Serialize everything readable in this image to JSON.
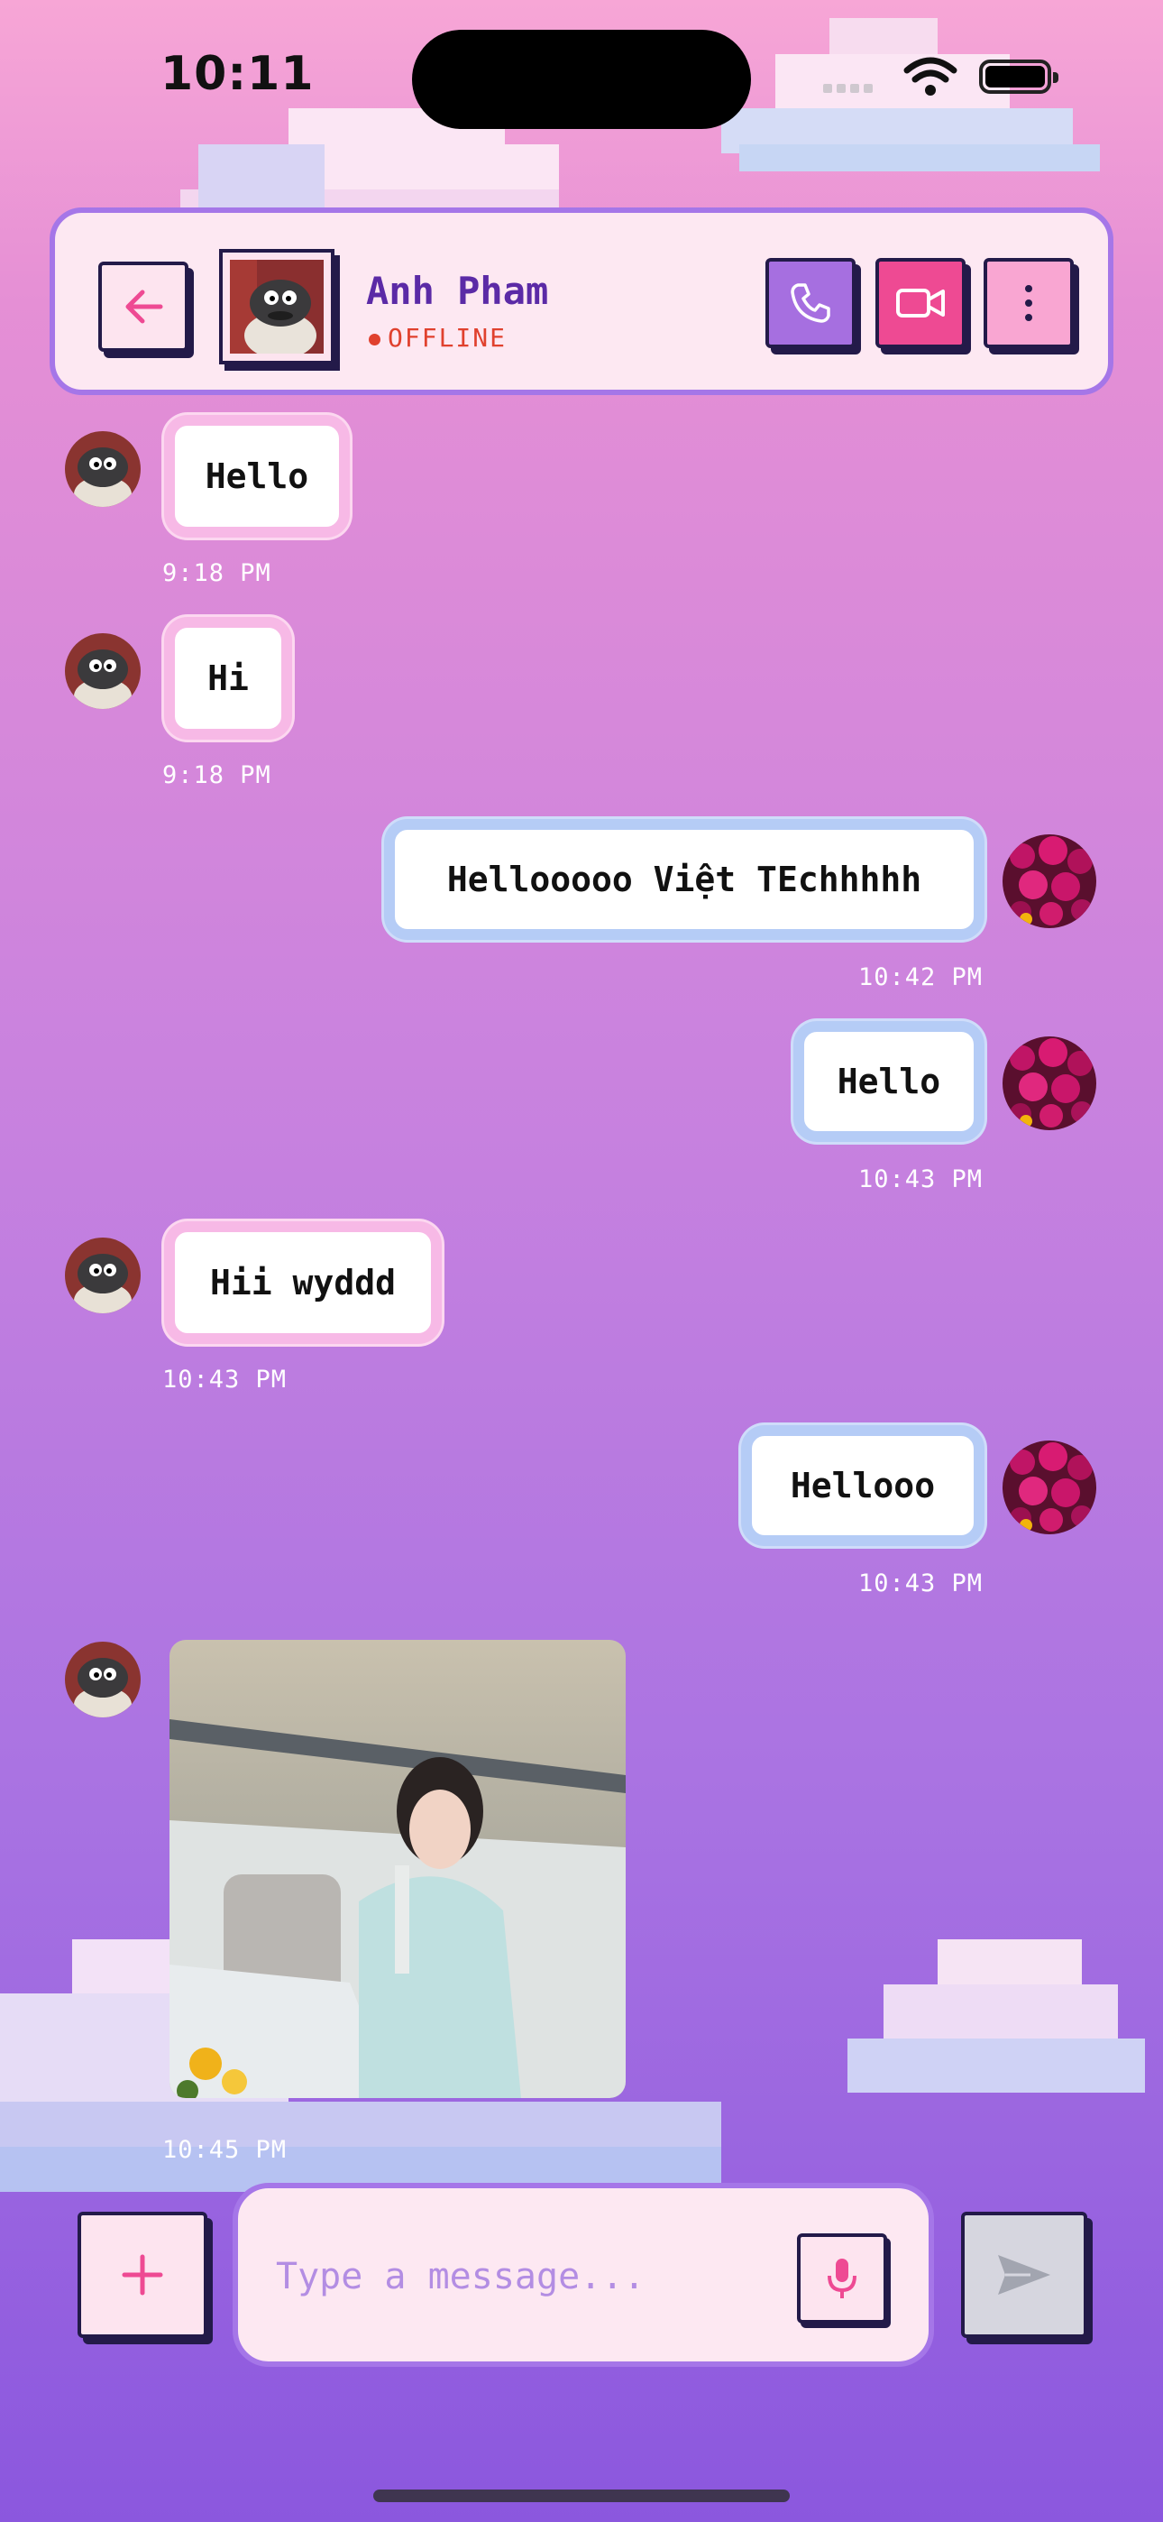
{
  "status_bar": {
    "time": "10:11"
  },
  "header": {
    "name": "Anh Pham",
    "status": "OFFLINE",
    "icons": {
      "back": "back-arrow-icon",
      "call": "phone-icon",
      "video": "video-camera-icon",
      "more": "more-vertical-icon"
    }
  },
  "messages": [
    {
      "side": "in",
      "text": "Hello",
      "time": "9:18 PM"
    },
    {
      "side": "in",
      "text": "Hi",
      "time": "9:18 PM"
    },
    {
      "side": "out",
      "text": "Hellooooo Việt TEchhhhh",
      "time": "10:42 PM"
    },
    {
      "side": "out",
      "text": "Hello",
      "time": "10:43 PM"
    },
    {
      "side": "in",
      "text": "Hii wyddd",
      "time": "10:43 PM"
    },
    {
      "side": "out",
      "text": "Hellooo",
      "time": "10:43 PM"
    },
    {
      "side": "in",
      "type": "image",
      "time": "10:45 PM"
    }
  ],
  "composer": {
    "placeholder": "Type a message...",
    "icons": {
      "add": "plus-icon",
      "mic": "microphone-icon",
      "send": "send-icon"
    }
  },
  "colors": {
    "accent_purple": "#a576e8",
    "accent_pink": "#ee4a93",
    "offline_red": "#e0412e",
    "outline_navy": "#231a49"
  }
}
